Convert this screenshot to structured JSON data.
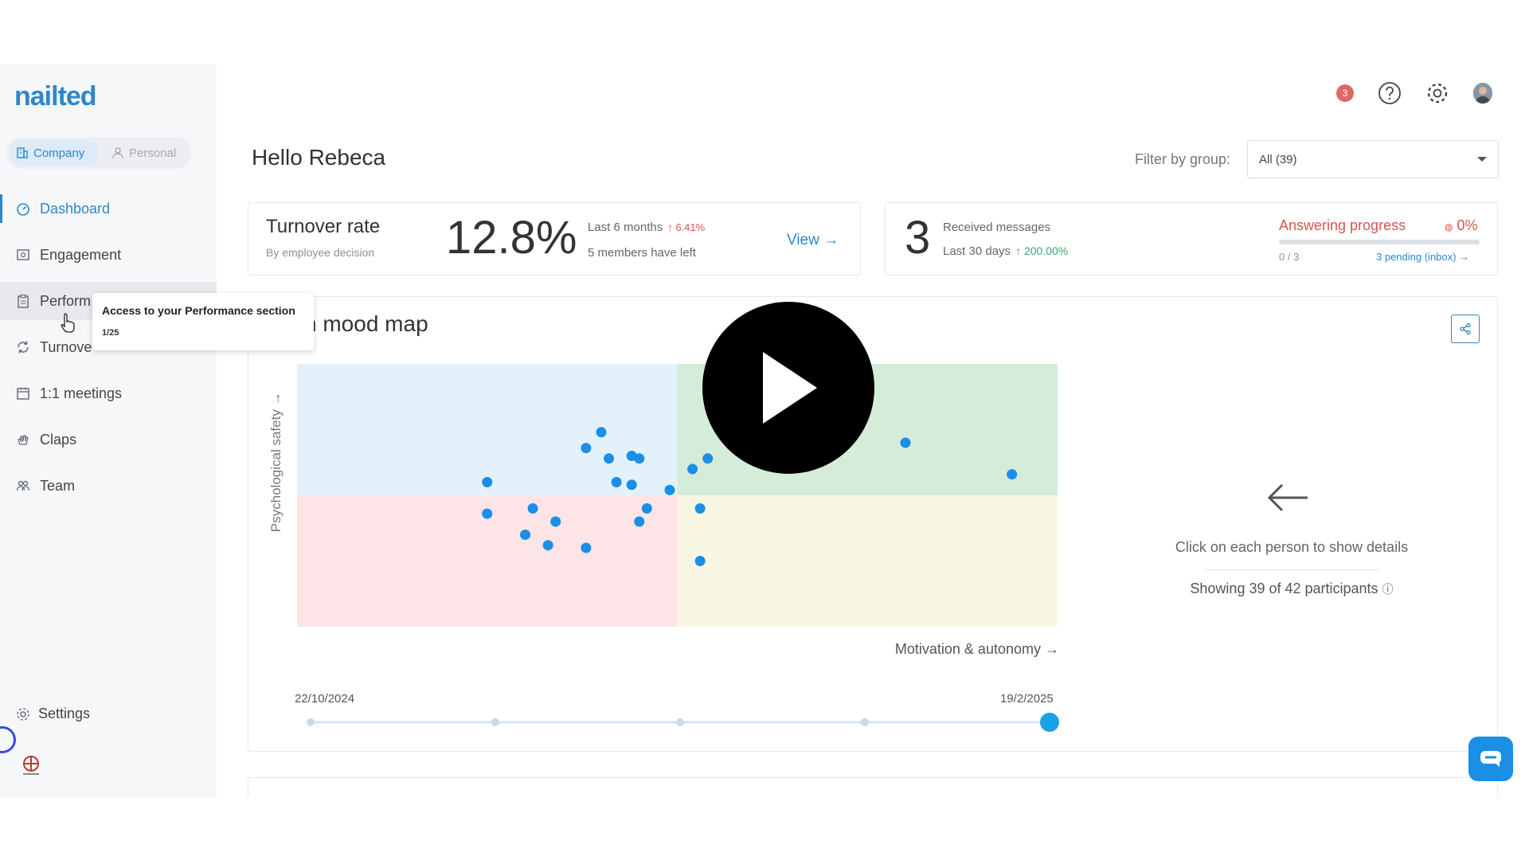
{
  "app": {
    "logo": "nailted"
  },
  "sidebar": {
    "scope": {
      "company": "Company",
      "personal": "Personal"
    },
    "items": [
      {
        "label": "Dashboard",
        "icon": "dashboard-icon"
      },
      {
        "label": "Engagement",
        "icon": "engagement-icon"
      },
      {
        "label": "Perform",
        "icon": "clipboard-icon"
      },
      {
        "label": "Turnove",
        "icon": "refresh-icon"
      },
      {
        "label": "1:1 meetings",
        "icon": "calendar-icon"
      },
      {
        "label": "Claps",
        "icon": "claps-icon"
      },
      {
        "label": "Team",
        "icon": "team-icon"
      }
    ],
    "settings": "Settings"
  },
  "tooltip": {
    "title": "Access to your Performance section",
    "step": "1/25"
  },
  "topbar": {
    "notifications": "3"
  },
  "header": {
    "greeting": "Hello Rebeca",
    "filter_label": "Filter by group:",
    "filter_value": "All (39)"
  },
  "turnover": {
    "title": "Turnover rate",
    "subtitle": "By employee decision",
    "rate": "12.8%",
    "period": "Last 6 months",
    "delta": "6.41%",
    "members_left": "5 members have left",
    "view": "View"
  },
  "messages": {
    "count": "3",
    "label": "Received messages",
    "period": "Last 30 days",
    "delta": "200.00%",
    "answering_title": "Answering progress",
    "answering_pct": "0%",
    "answering_fraction": 0,
    "answered": "0 / 3",
    "pending": "3 pending (inbox)"
  },
  "mood_map": {
    "title": "n mood map",
    "detail_hint": "Click on each person to show details",
    "showing": "Showing 39 of 42 participants",
    "slider": {
      "start": "22/10/2024",
      "end": "19/2/2025",
      "steps": 5,
      "selected": 5
    }
  },
  "chart_data": {
    "type": "scatter",
    "xlabel": "Motivation & autonomy →",
    "ylabel": "Psychological safety →",
    "xlim": [
      0,
      100
    ],
    "ylim": [
      0,
      100
    ],
    "quadrant_colors": {
      "top_left": "#e3f1fb",
      "top_right": "#d5ecd9",
      "bottom_left": "#fde4e6",
      "bottom_right": "#f9f7e4"
    },
    "point_color": "#1b8fe6",
    "points": [
      [
        25,
        55
      ],
      [
        25,
        43
      ],
      [
        31,
        45
      ],
      [
        30,
        35
      ],
      [
        33,
        31
      ],
      [
        34,
        40
      ],
      [
        38,
        68
      ],
      [
        40,
        74
      ],
      [
        38,
        30
      ],
      [
        41,
        64
      ],
      [
        42,
        55
      ],
      [
        44,
        65
      ],
      [
        44,
        54
      ],
      [
        45,
        64
      ],
      [
        45,
        40
      ],
      [
        46,
        45
      ],
      [
        49,
        52
      ],
      [
        52,
        60
      ],
      [
        53,
        45
      ],
      [
        53,
        25
      ],
      [
        54,
        64
      ],
      [
        75,
        86
      ],
      [
        80,
        70
      ],
      [
        94,
        58
      ]
    ]
  },
  "colors": {
    "accent": "#2f86c9",
    "danger": "#d9534f",
    "success": "#3aa66c"
  }
}
